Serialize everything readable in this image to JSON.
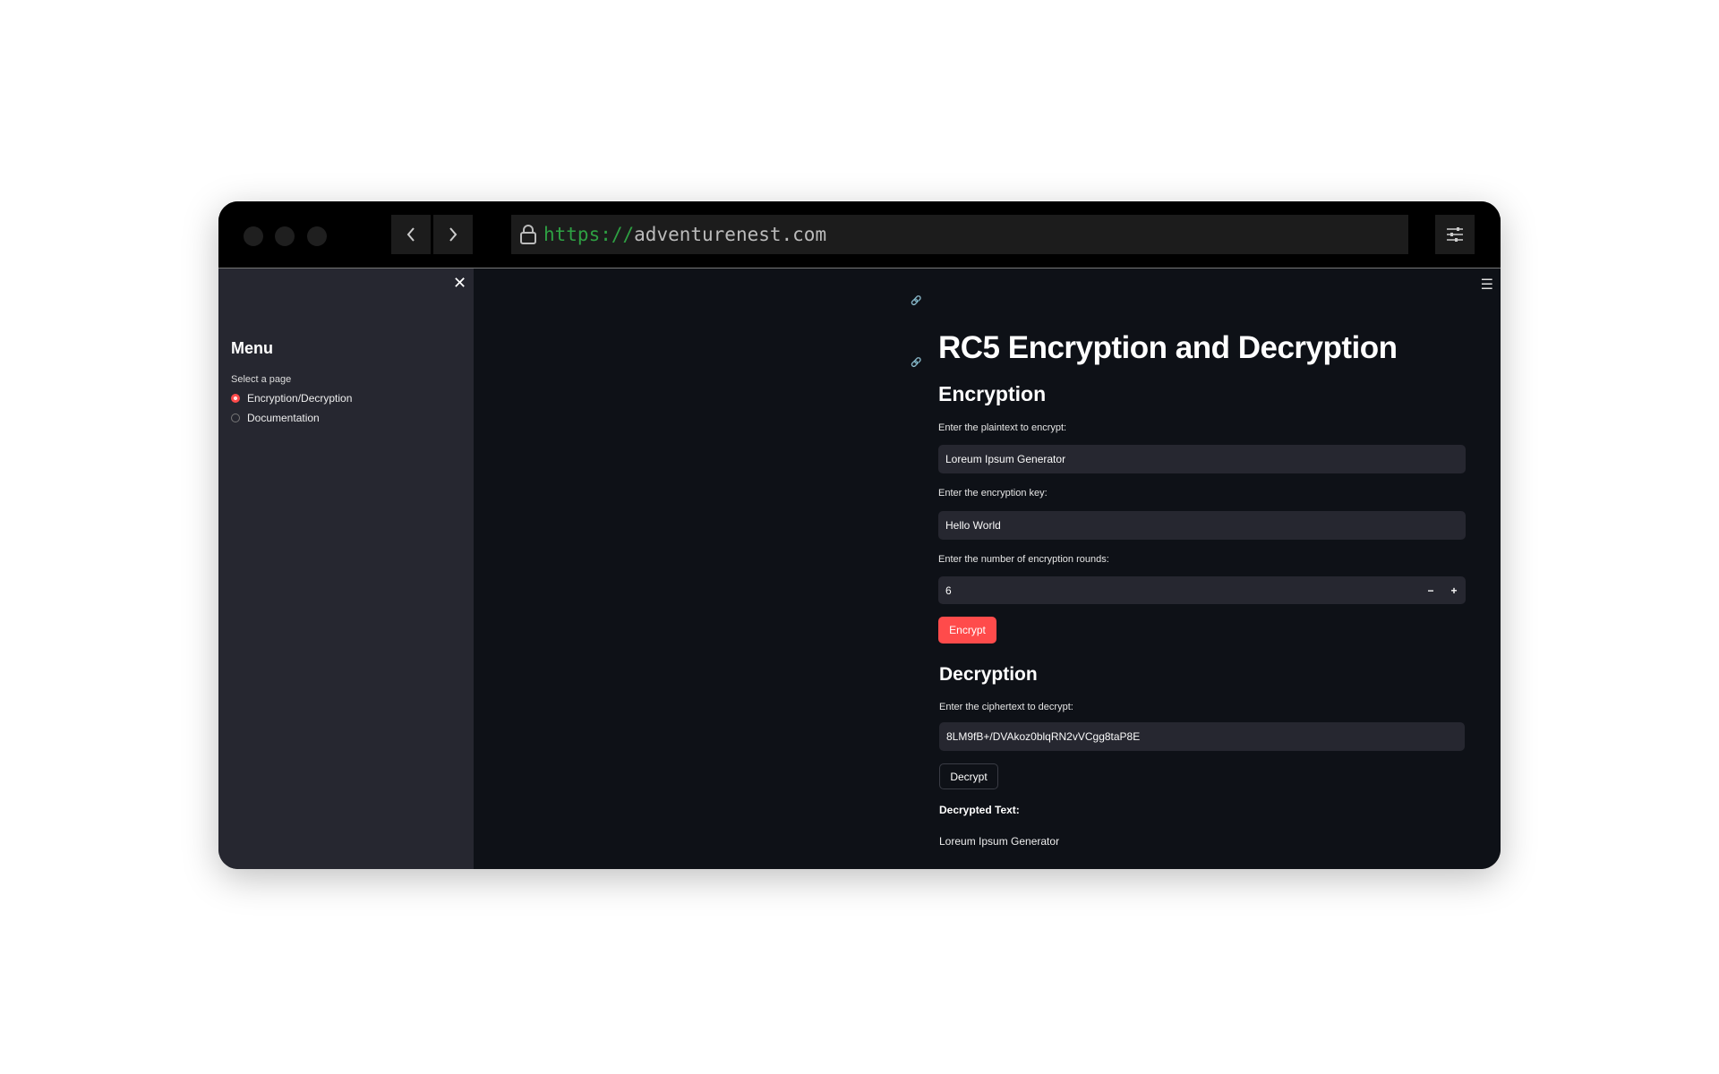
{
  "browser": {
    "url_scheme": "https://",
    "url_host": "adventurenest.com"
  },
  "sidebar": {
    "close_label": "✕",
    "title": "Menu",
    "select_label": "Select a page",
    "options": [
      {
        "label": "Encryption/Decryption",
        "selected": true
      },
      {
        "label": "Documentation",
        "selected": false
      }
    ]
  },
  "main": {
    "menu_icon": "☰",
    "title": "RC5 Encryption and Decryption",
    "encryption": {
      "heading": "Encryption",
      "plaintext_label": "Enter the plaintext to encrypt:",
      "plaintext_value": "Loreum Ipsum Generator",
      "key_label": "Enter the encryption key:",
      "key_value": "Hello World",
      "rounds_label": "Enter the number of encryption rounds:",
      "rounds_value": "6",
      "minus": "−",
      "plus": "+",
      "button": "Encrypt"
    },
    "decryption": {
      "heading": "Decryption",
      "ciphertext_label": "Enter the ciphertext to decrypt:",
      "ciphertext_value": "8LM9fB+/DVAkoz0blqRN2vVCgg8taP8E",
      "button": "Decrypt",
      "result_label": "Decrypted Text:",
      "result_value": "Loreum Ipsum Generator"
    }
  },
  "colors": {
    "accent": "#ff4b4b",
    "background": "#0e1117",
    "sidebar": "#262730",
    "url_scheme": "#2ea043"
  }
}
